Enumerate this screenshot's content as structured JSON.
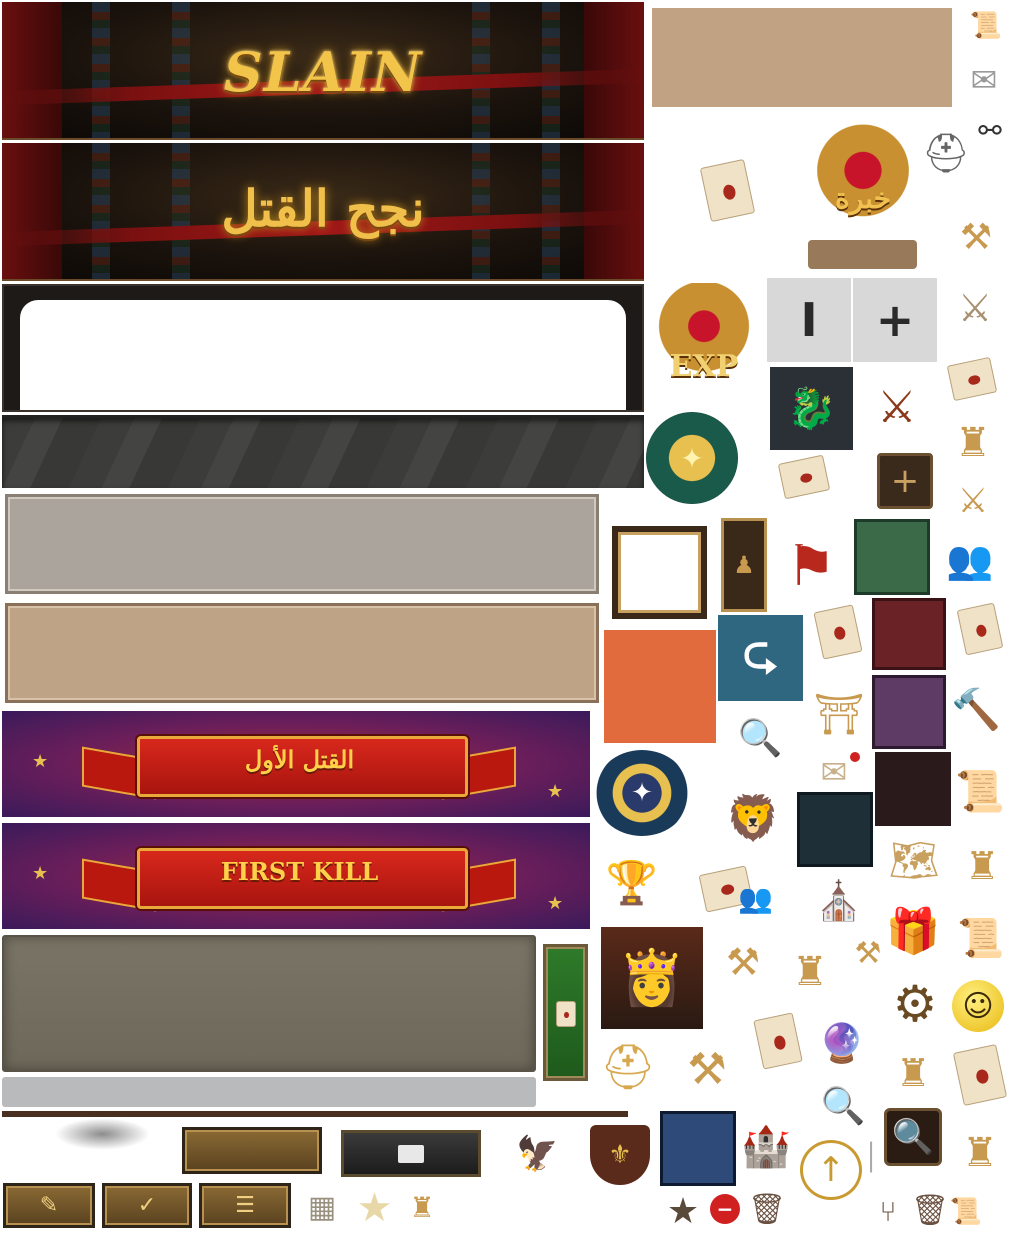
{
  "banners": {
    "slain_en": "SLAIN",
    "slain_ar": "نجح القتل",
    "first_kill_ar": "القتل الأول",
    "first_kill_en": "FIRST KILL"
  },
  "badges": {
    "rage_ar": "خبرة",
    "exp": "EXP"
  },
  "tiles": {
    "minus": "I",
    "plus": "+"
  },
  "colors": {
    "tan": "#c1a283",
    "brown_bar": "#987a5a",
    "green": "#3b6a49",
    "crimson": "#6b2226",
    "orange": "#e26b3e",
    "steel_blue": "#2f6680",
    "purple": "#5e3b64",
    "dark_maroon": "#2a1a1c",
    "dark_teal": "#1f2f38",
    "navy": "#2e4a78"
  },
  "icons": [
    "scroll-quill-icon",
    "rage-shield-badge-icon",
    "knight-helmet-icon",
    "share-icon",
    "crossed-swords-icon",
    "exp-shield-badge-icon",
    "dragon-portrait-icon",
    "armored-warrior-icon",
    "sealed-letter-icon",
    "gold-star-medal-icon",
    "mail-icon",
    "add-button-icon",
    "catapult-icon",
    "castle-gate-icon",
    "flag-standard-icon",
    "group-icon",
    "trophy-icon",
    "gift-box-icon",
    "gear-icon",
    "smiley-icon",
    "magnifier-icon",
    "trash-icon",
    "star-icon",
    "no-entry-icon",
    "upgrade-arrow-icon",
    "warrior-woman-portrait-icon",
    "spartan-helmet-icon",
    "griffin-icon",
    "edit-icon",
    "check-icon",
    "checklist-icon"
  ]
}
